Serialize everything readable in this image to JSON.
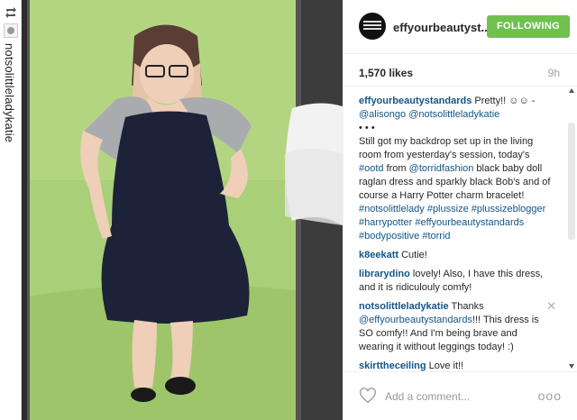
{
  "strip": {
    "username": "notsolittleladykatie"
  },
  "post": {
    "username": "effyourbeautyst...",
    "follow_label": "FOLLOWING",
    "likes": "1,570 likes",
    "time": "9h"
  },
  "comments": [
    {
      "user": "effyourbeautystandards",
      "text": "Pretty!! ☺☺ - "
    },
    {
      "user": "k8eekatt",
      "text": "Cutie!"
    },
    {
      "user": "librarydino",
      "text": "lovely! Also, I have this dress, and it is ridiculouly comfy!"
    },
    {
      "user": "notsolittleladykatie",
      "text": "Thanks "
    },
    {
      "user": "skirttheceiling",
      "text": "Love it!!"
    }
  ],
  "caption": {
    "mention_1": "@alisongo",
    "mention_2": "@notsolittleladykatie",
    "ellipsis": "• • •",
    "body_1": "Still got my backdrop set up in the living room from yesterday's session, today's ",
    "tag_ootd": "#ootd",
    "body_2": " from ",
    "mention_torrid": "@torridfashion",
    "body_3": " black baby doll raglan dress and sparkly black Bob's and of course a Harry Potter charm bracelet! ",
    "tags": "#notsolittlelady #plussize #plussizeblogger #harrypotter #effyourbeautystandards #bodypositive #torrid"
  },
  "reply": {
    "mention": "@effyourbeautystandards",
    "text": "!!! This dress is SO comfy!! And I'm being brave and wearing it without leggings today! :)"
  },
  "footer": {
    "placeholder": "Add a comment...",
    "more": "ooo"
  },
  "colors": {
    "follow_button": "#70c050",
    "username_link": "#125688",
    "backdrop": "#a6cc73"
  },
  "icons": [
    "repost-icon",
    "heart-icon",
    "close-icon",
    "more-options-icon"
  ]
}
